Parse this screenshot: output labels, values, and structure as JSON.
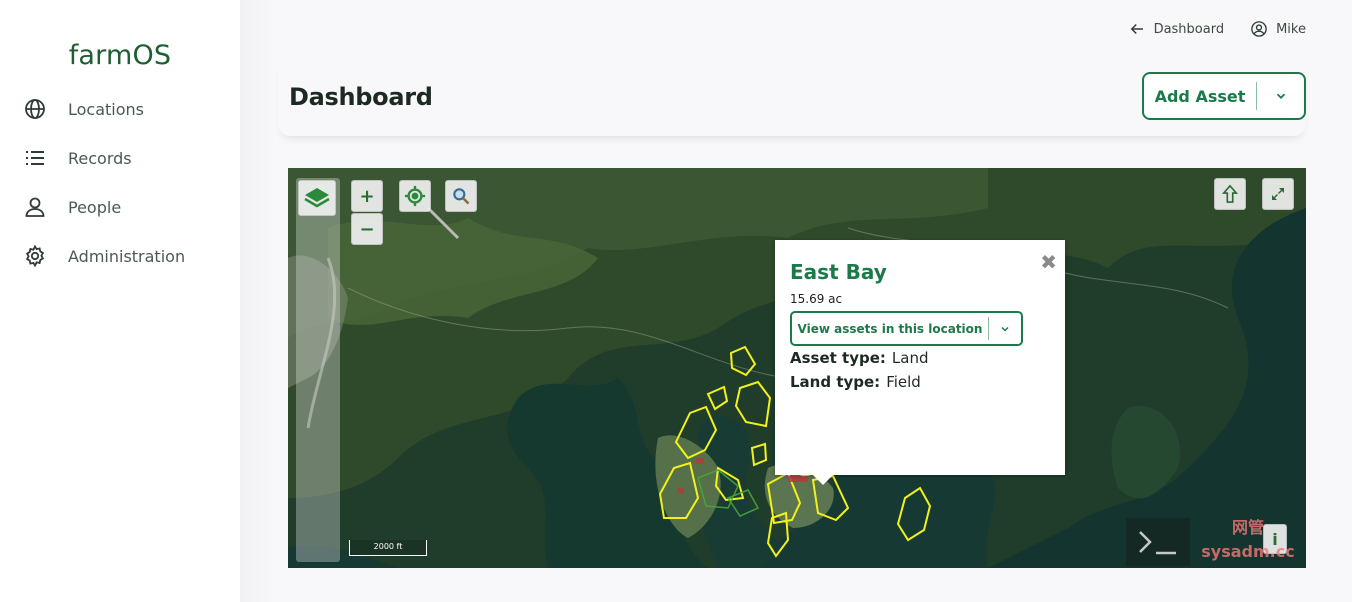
{
  "app": {
    "logo": "farmOS"
  },
  "sidebar": {
    "items": [
      {
        "label": "Locations",
        "icon": "globe-icon"
      },
      {
        "label": "Records",
        "icon": "list-icon"
      },
      {
        "label": "People",
        "icon": "user-icon"
      },
      {
        "label": "Administration",
        "icon": "gear-icon"
      }
    ]
  },
  "topbar": {
    "back_link": "Dashboard",
    "user_name": "Mike"
  },
  "header": {
    "title": "Dashboard",
    "add_asset_label": "Add Asset"
  },
  "map": {
    "zoom_in": "+",
    "zoom_out": "−",
    "scale_label": "2000 ft",
    "info_label": "i",
    "popup": {
      "title": "East Bay",
      "area": "15.69 ac",
      "view_assets_label": "View assets in this location",
      "asset_type_label": "Asset type:",
      "asset_type_value": "Land",
      "land_type_label": "Land type:",
      "land_type_value": "Field"
    }
  },
  "watermark": {
    "line1": "网管",
    "line2": "sysadm.cc"
  },
  "colors": {
    "brand_green": "#1b7a4a",
    "field_outline": "#f2f21a"
  }
}
